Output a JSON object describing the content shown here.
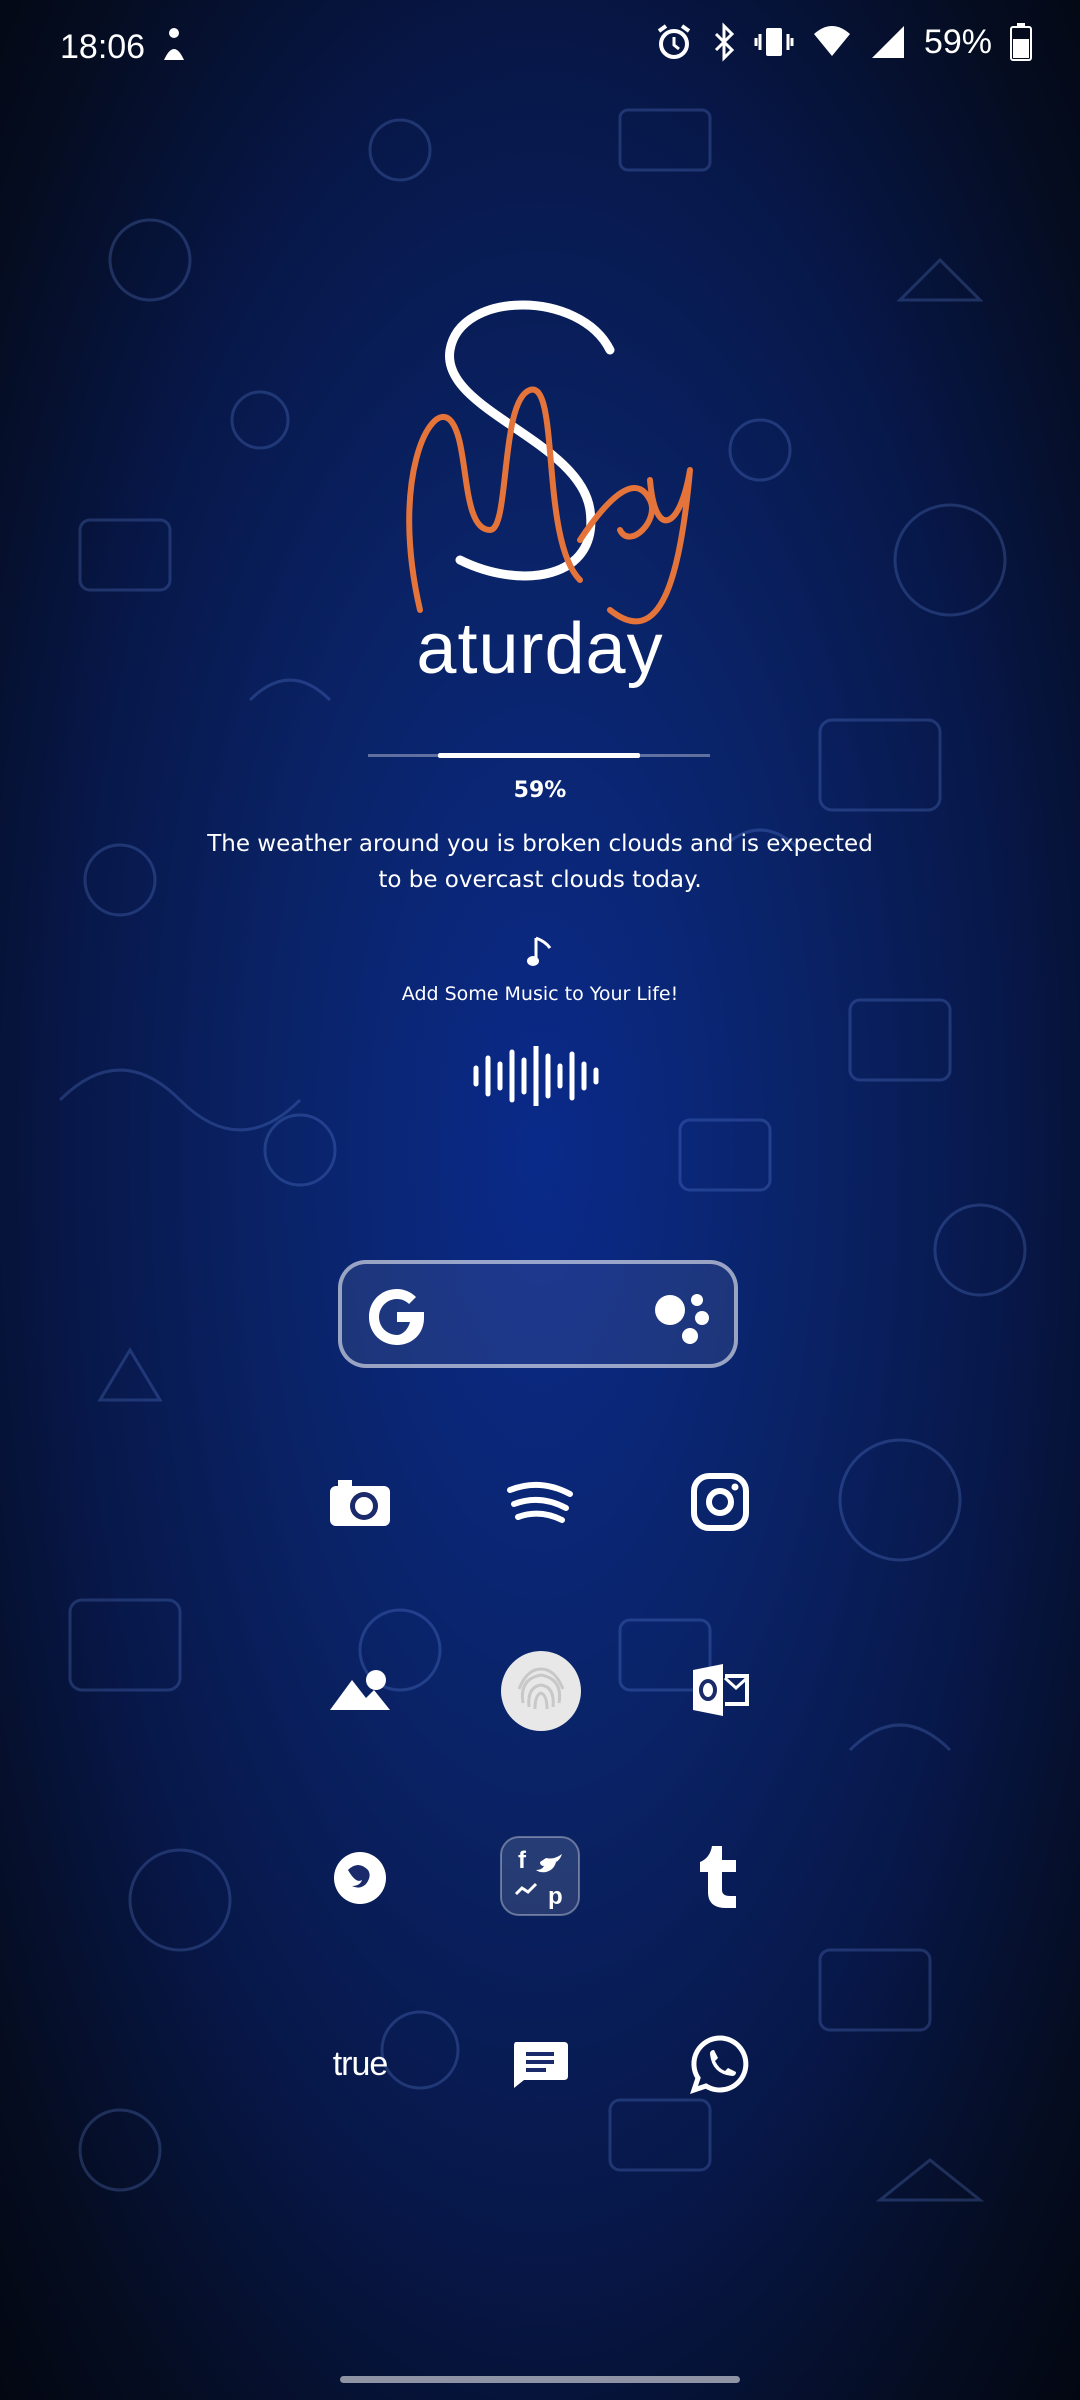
{
  "status": {
    "time": "18:06",
    "battery": "59%",
    "icons": [
      "accessibility-icon",
      "alarm-icon",
      "bluetooth-icon",
      "vibrate-icon",
      "wifi-icon",
      "signal-icon",
      "battery-icon"
    ]
  },
  "widget": {
    "month_script": "May",
    "day_letter": "S",
    "day_rest": "aturday",
    "battery_percent": "59%",
    "battery_level": 0.59,
    "weather_text": "The weather around you is broken clouds and is expected to be overcast clouds today.",
    "music_text": "Add Some Music to Your Life!",
    "accent_color": "#E5743A"
  },
  "search": {
    "icons": [
      "google-g-icon",
      "assistant-icon"
    ]
  },
  "apps": {
    "row1": [
      "camera-icon",
      "spotify-icon",
      "instagram-icon"
    ],
    "row2": [
      "gallery-icon",
      "fingerprint-icon",
      "outlook-icon"
    ],
    "row3": [
      "firefox-icon",
      "social-folder-icon",
      "tumblr-icon"
    ],
    "dock": [
      "truecaller",
      "messages-icon",
      "whatsapp-icon"
    ],
    "truecaller_label": "true"
  }
}
